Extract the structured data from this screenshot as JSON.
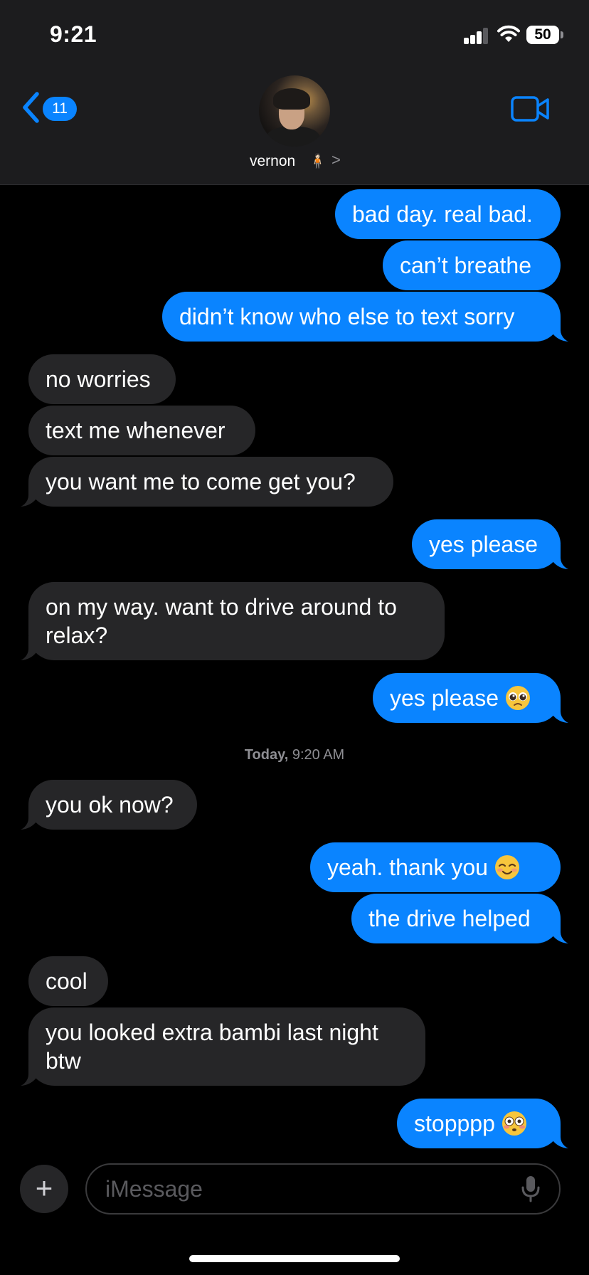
{
  "status_bar": {
    "time": "9:21",
    "battery": "50"
  },
  "header": {
    "back_count": "11",
    "contact_name": "vernon",
    "contact_emoji": "🧍🏻",
    "chevron": ">"
  },
  "messages": [
    {
      "side": "out",
      "text": "bad day. real bad."
    },
    {
      "side": "out",
      "text": "can’t breathe"
    },
    {
      "side": "out",
      "text": "didn’t know who else to text sorry"
    },
    {
      "side": "in",
      "text": "no worries"
    },
    {
      "side": "in",
      "text": "text me whenever"
    },
    {
      "side": "in",
      "text": "you want me to come get you?"
    },
    {
      "side": "out",
      "text": "yes please"
    },
    {
      "side": "in",
      "text": "on my way. want to drive around to relax?"
    },
    {
      "side": "out",
      "text": "yes please",
      "emoji": "pleading-face"
    },
    {
      "side": "in",
      "text": "you ok now?"
    },
    {
      "side": "out",
      "text": "yeah. thank you",
      "emoji": "smiling-face"
    },
    {
      "side": "out",
      "text": "the drive helped"
    },
    {
      "side": "in",
      "text": "cool"
    },
    {
      "side": "in",
      "text": "you looked extra bambi last night btw"
    },
    {
      "side": "out",
      "text": "stopppp",
      "emoji": "flushed-face"
    }
  ],
  "timestamp": {
    "day": "Today,",
    "time": "9:20 AM"
  },
  "composer": {
    "placeholder": "iMessage",
    "plus": "+"
  },
  "colors": {
    "outgoing": "#0a84ff",
    "incoming": "#262628",
    "background": "#000000",
    "header": "#1c1c1e"
  },
  "icons": [
    "back-chevron-icon",
    "video-camera-icon",
    "plus-icon",
    "microphone-icon",
    "signal-icon",
    "wifi-icon",
    "battery-icon"
  ]
}
